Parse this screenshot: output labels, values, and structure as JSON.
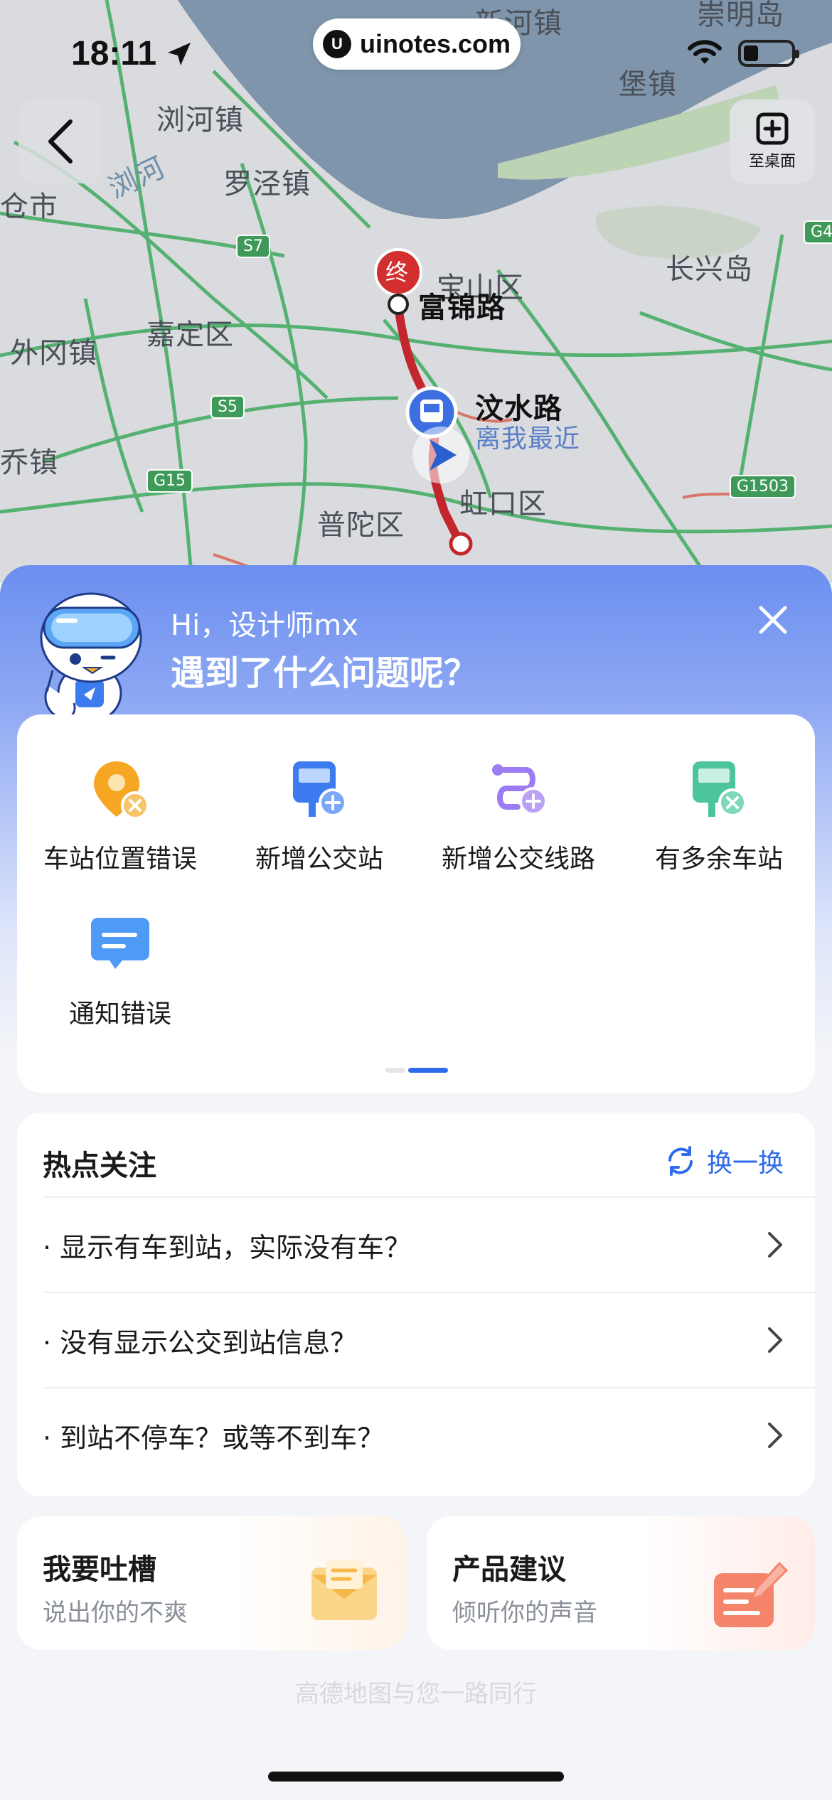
{
  "status_bar": {
    "time": "18:11"
  },
  "watermark": {
    "logo": "U",
    "text": "uinotes.com"
  },
  "map": {
    "desk_button_label": "至桌面",
    "labels": {
      "xinhe": "新河镇",
      "baozhen": "堡镇",
      "zongming": "崇明岛",
      "liuhe": "浏河镇",
      "liuhe_river": "浏河",
      "luojing": "罗泾镇",
      "cangshi": "仓市",
      "baoshan": "宝山区",
      "fujinlu": "富锦路",
      "changxing": "长兴岛",
      "jiading": "嘉定区",
      "waigang": "外冈镇",
      "wenshuilu": "汶水路",
      "nearest": "离我最近",
      "hongkou": "虹口区",
      "putuo": "普陀区",
      "qiao": "乔镇",
      "end_marker": "终",
      "s7": "S7",
      "s5": "S5",
      "g15": "G15",
      "g1503": "G1503",
      "g4": "G4"
    }
  },
  "feedback": {
    "greeting": "Hi，设计师mx",
    "question": "遇到了什么问题呢？",
    "options": [
      {
        "label": "车站位置错误",
        "icon": "location-error-icon"
      },
      {
        "label": "新增公交站",
        "icon": "add-bus-stop-icon"
      },
      {
        "label": "新增公交线路",
        "icon": "add-bus-route-icon"
      },
      {
        "label": "有多余车站",
        "icon": "redundant-stop-icon"
      },
      {
        "label": "通知错误",
        "icon": "notice-error-icon"
      }
    ],
    "page_indicator": {
      "pages": 2,
      "active": 2
    }
  },
  "hot_topics": {
    "title": "热点关注",
    "refresh_label": "换一换",
    "items": [
      "· 显示有车到站，实际没有车？",
      "· 没有显示公交到站信息？",
      "· 到站不停车？或等不到车？"
    ]
  },
  "feedback_cards": {
    "complain": {
      "title": "我要吐槽",
      "subtitle": "说出你的不爽",
      "icon": "mail-icon"
    },
    "suggest": {
      "title": "产品建议",
      "subtitle": "倾听你的声音",
      "icon": "edit-icon"
    }
  },
  "footer": {
    "slogan": "高德地图与您一路同行"
  },
  "colors": {
    "accent": "#2f6bea",
    "route": "#c4262e",
    "orange": "#f7a623",
    "purple": "#9b7cf2",
    "green": "#4cc59d"
  }
}
